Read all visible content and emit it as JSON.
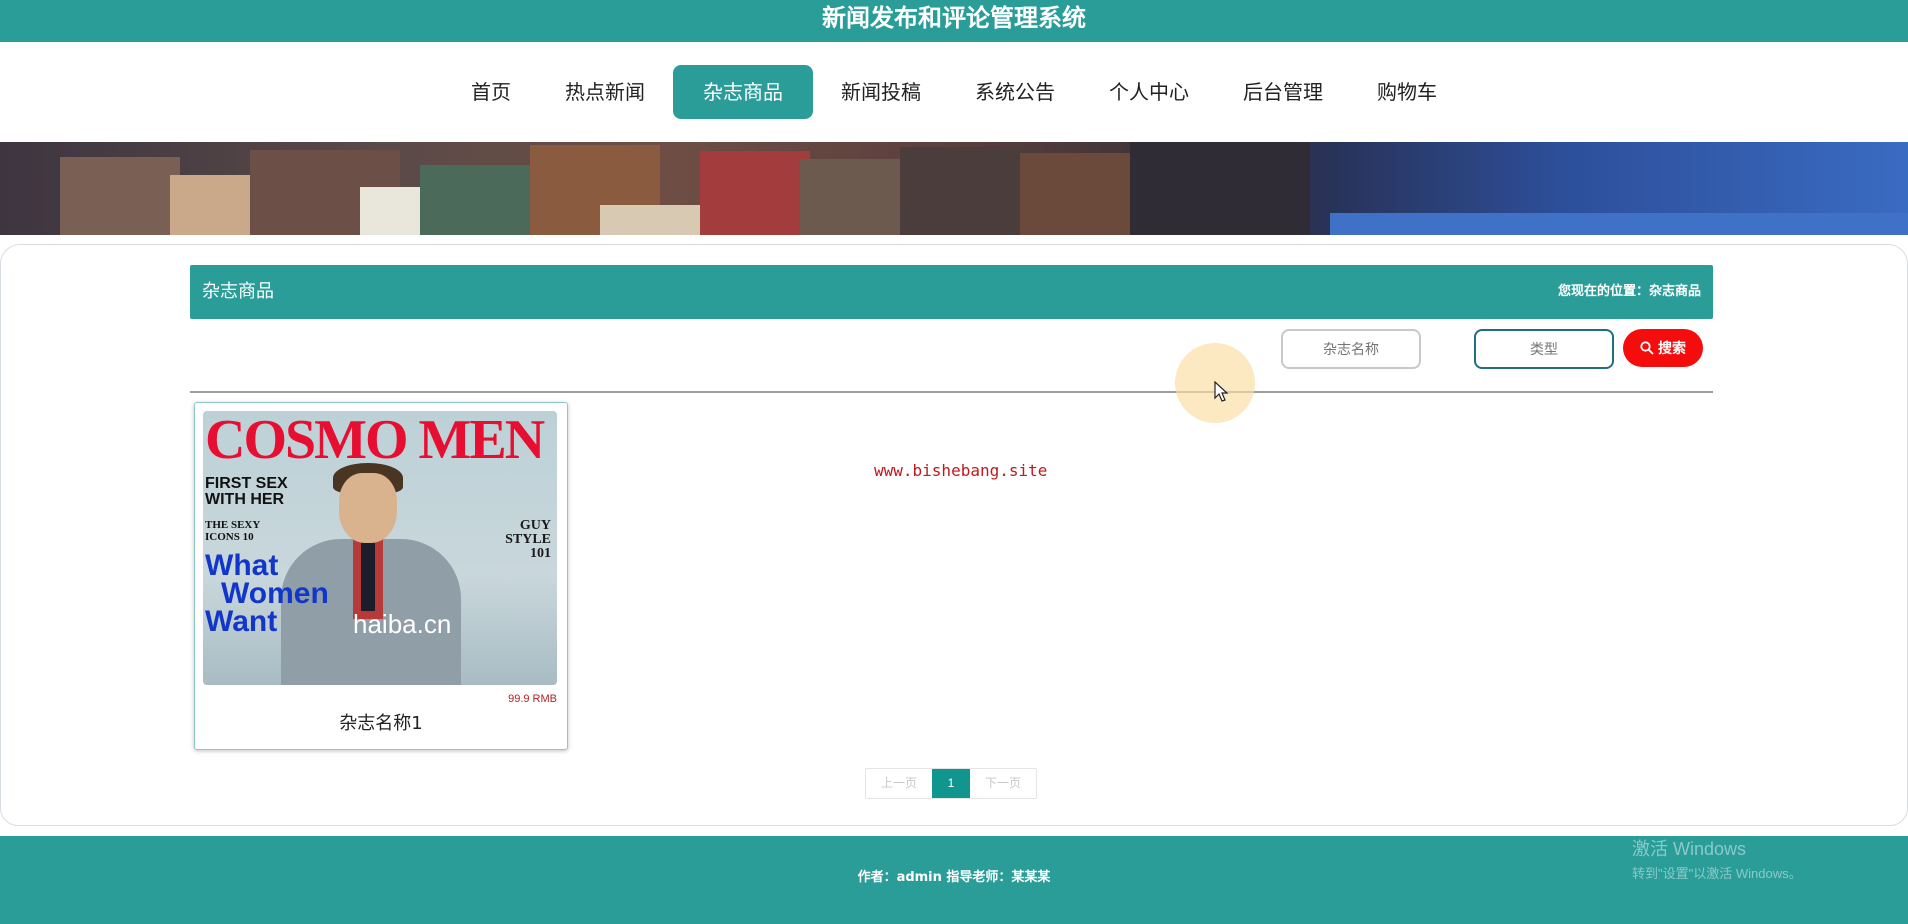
{
  "app": {
    "title": "新闻发布和评论管理系统"
  },
  "nav": {
    "items": [
      {
        "label": "首页"
      },
      {
        "label": "热点新闻"
      },
      {
        "label": "杂志商品"
      },
      {
        "label": "新闻投稿"
      },
      {
        "label": "系统公告"
      },
      {
        "label": "个人中心"
      },
      {
        "label": "后台管理"
      },
      {
        "label": "购物车"
      }
    ],
    "active": "杂志商品"
  },
  "section": {
    "title": "杂志商品",
    "breadcrumb": "您现在的位置：杂志商品"
  },
  "search": {
    "name_placeholder": "杂志名称",
    "type_placeholder": "类型",
    "button_label": "搜索"
  },
  "products": [
    {
      "name": "杂志名称1",
      "price": "99.9 RMB",
      "cover": {
        "title": "COSMO MEN",
        "line1": "FIRST SEX",
        "line2": "WITH HER",
        "line3": "THE SEXY",
        "line4": "ICONS 10",
        "blue1": "What",
        "blue2": "Women",
        "blue3": "Want",
        "side1": "GUY",
        "side2": "STYLE",
        "side3": "101",
        "brand": "haiba.cn"
      }
    }
  ],
  "watermark_text": "www.bishebang.site",
  "pagination": {
    "prev": "上一页",
    "current": "1",
    "next": "下一页"
  },
  "footer": {
    "text": "作者：admin 指导老师：某某某"
  },
  "os_watermark": {
    "line1": "激活 Windows",
    "line2": "转到\"设置\"以激活 Windows。"
  },
  "colors": {
    "primary": "#2a9d99",
    "search_button": "#f50d0d",
    "price": "#b22222",
    "page_active": "#10958f"
  }
}
